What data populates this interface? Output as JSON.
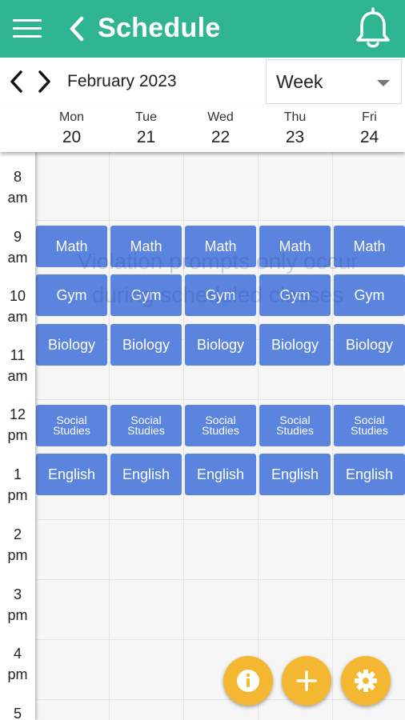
{
  "app_bar": {
    "title": "Schedule",
    "background": "#2fb592",
    "icons": [
      "menu-icon",
      "back-arrow-icon",
      "bell-icon"
    ]
  },
  "date_nav": {
    "month_label": "February 2023",
    "view_selected": "Week",
    "icons": [
      "chevron-left-icon",
      "chevron-right-icon",
      "dropdown-caret-icon"
    ]
  },
  "days": [
    {
      "name": "Mon",
      "num": "20"
    },
    {
      "name": "Tue",
      "num": "21"
    },
    {
      "name": "Wed",
      "num": "22"
    },
    {
      "name": "Thu",
      "num": "23"
    },
    {
      "name": "Fri",
      "num": "24"
    }
  ],
  "hours": [
    {
      "num": "8",
      "ampm": "am"
    },
    {
      "num": "9",
      "ampm": "am"
    },
    {
      "num": "10",
      "ampm": "am"
    },
    {
      "num": "11",
      "ampm": "am"
    },
    {
      "num": "12",
      "ampm": "pm"
    },
    {
      "num": "1",
      "ampm": "pm"
    },
    {
      "num": "2",
      "ampm": "pm"
    },
    {
      "num": "3",
      "ampm": "pm"
    },
    {
      "num": "4",
      "ampm": "pm"
    },
    {
      "num": "5",
      "ampm": ""
    }
  ],
  "subjects": {
    "math": "Math",
    "gym": "Gym",
    "biology": "Biology",
    "social_line1": "Social",
    "social_line2": "Studies",
    "english": "English"
  },
  "event_color": "#5b84de",
  "watermark": {
    "line1": "Violation prompts only occur",
    "line2": "during scheduled classes"
  },
  "fab": {
    "color": "#f4b731",
    "icons": [
      "info-icon",
      "plus-icon",
      "settings-gear-icon"
    ]
  }
}
